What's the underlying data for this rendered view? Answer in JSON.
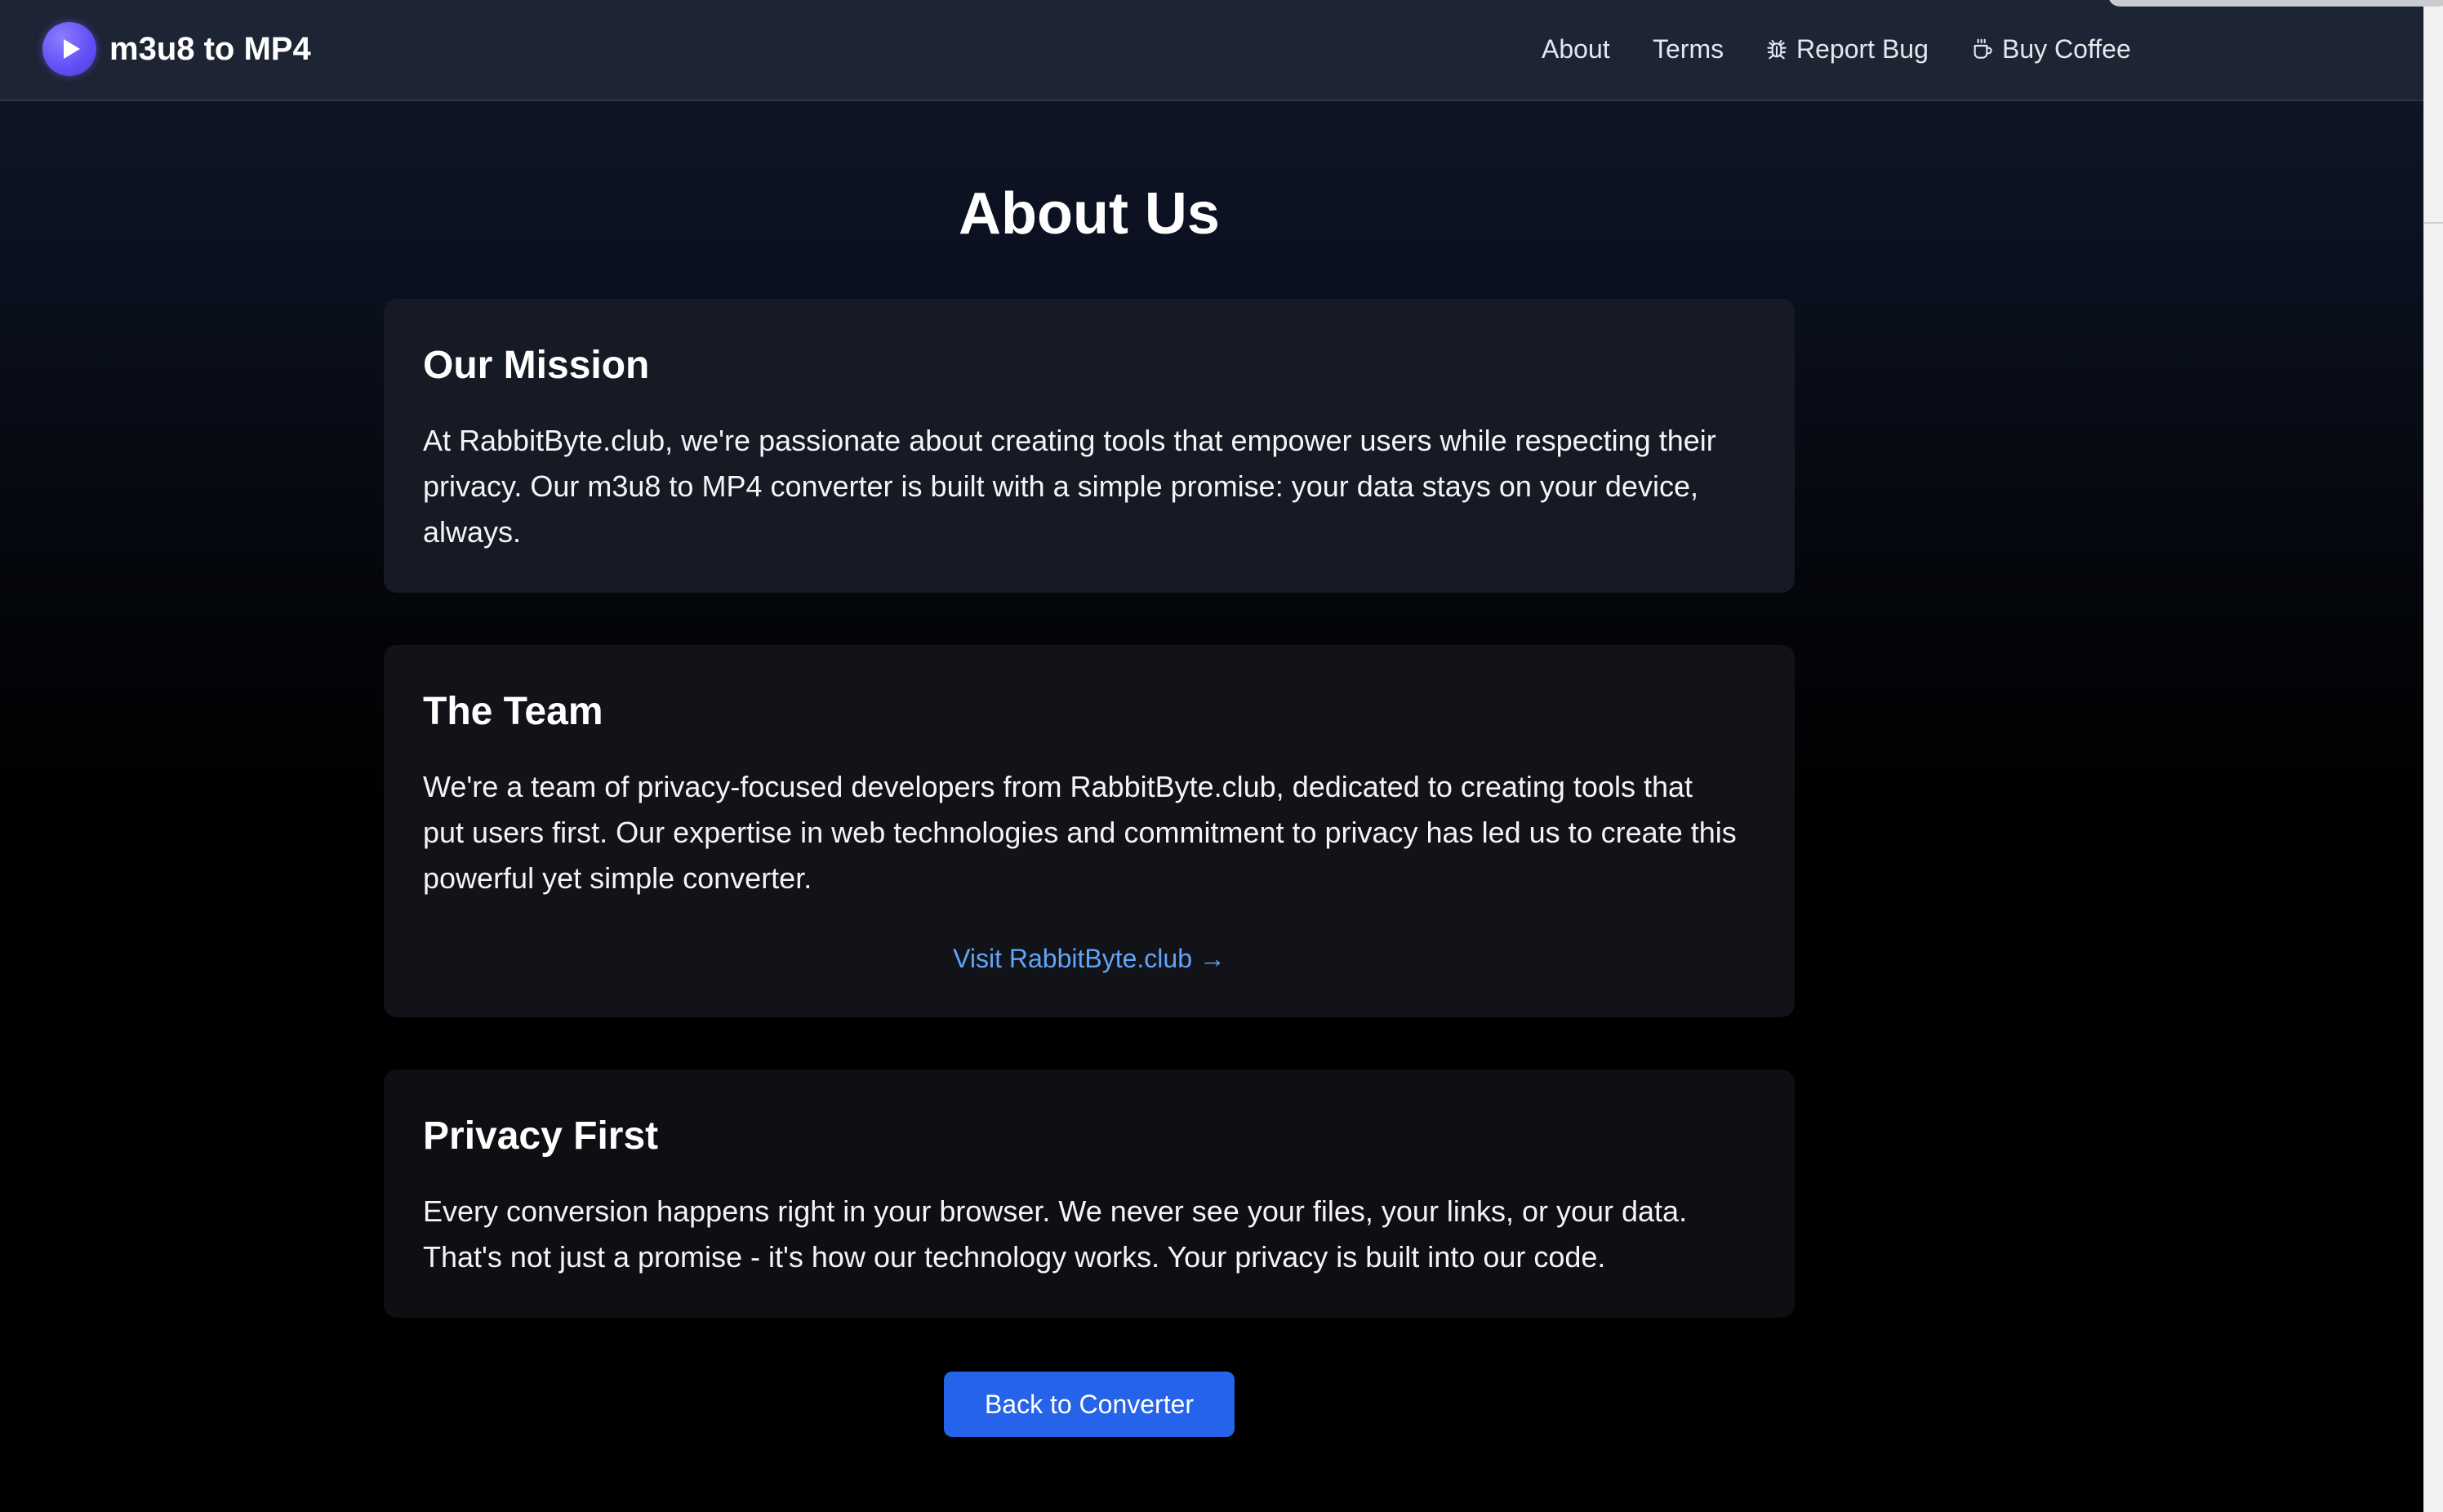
{
  "header": {
    "brand": "m3u8 to MP4",
    "nav": {
      "about": "About",
      "terms": "Terms",
      "report_bug": "Report Bug",
      "buy_coffee": "Buy Coffee"
    },
    "icons": [
      "play-icon",
      "bug-icon",
      "coffee-cup-icon"
    ]
  },
  "main": {
    "title": "About Us",
    "sections": [
      {
        "heading": "Our Mission",
        "lines": [
          "At RabbitByte.club, we're passionate about creating tools that empower users while respecting their",
          "privacy. Our m3u8 to MP4 converter is built with a simple promise: your data stays on your device,",
          "always."
        ]
      },
      {
        "heading": "The Team",
        "lines": [
          "We're a team of privacy-focused developers from RabbitByte.club, dedicated to creating tools that",
          "put users first. Our expertise in web technologies and commitment to privacy has led us to create this",
          "powerful yet simple converter."
        ],
        "link": "Visit RabbitByte.club →"
      },
      {
        "heading": "Privacy First",
        "lines": [
          "Every conversion happens right in your browser. We never see your files, your links, or your data.",
          "That's not just a promise - it's how our technology works. Your privacy is built into our code."
        ]
      }
    ],
    "back_button": "Back to Converter"
  },
  "colors": {
    "accent": "#2563eb",
    "link": "#60a5fa",
    "logo": "#6352f5",
    "header_bg": "#1d2433",
    "card_bg": "#161a22"
  }
}
